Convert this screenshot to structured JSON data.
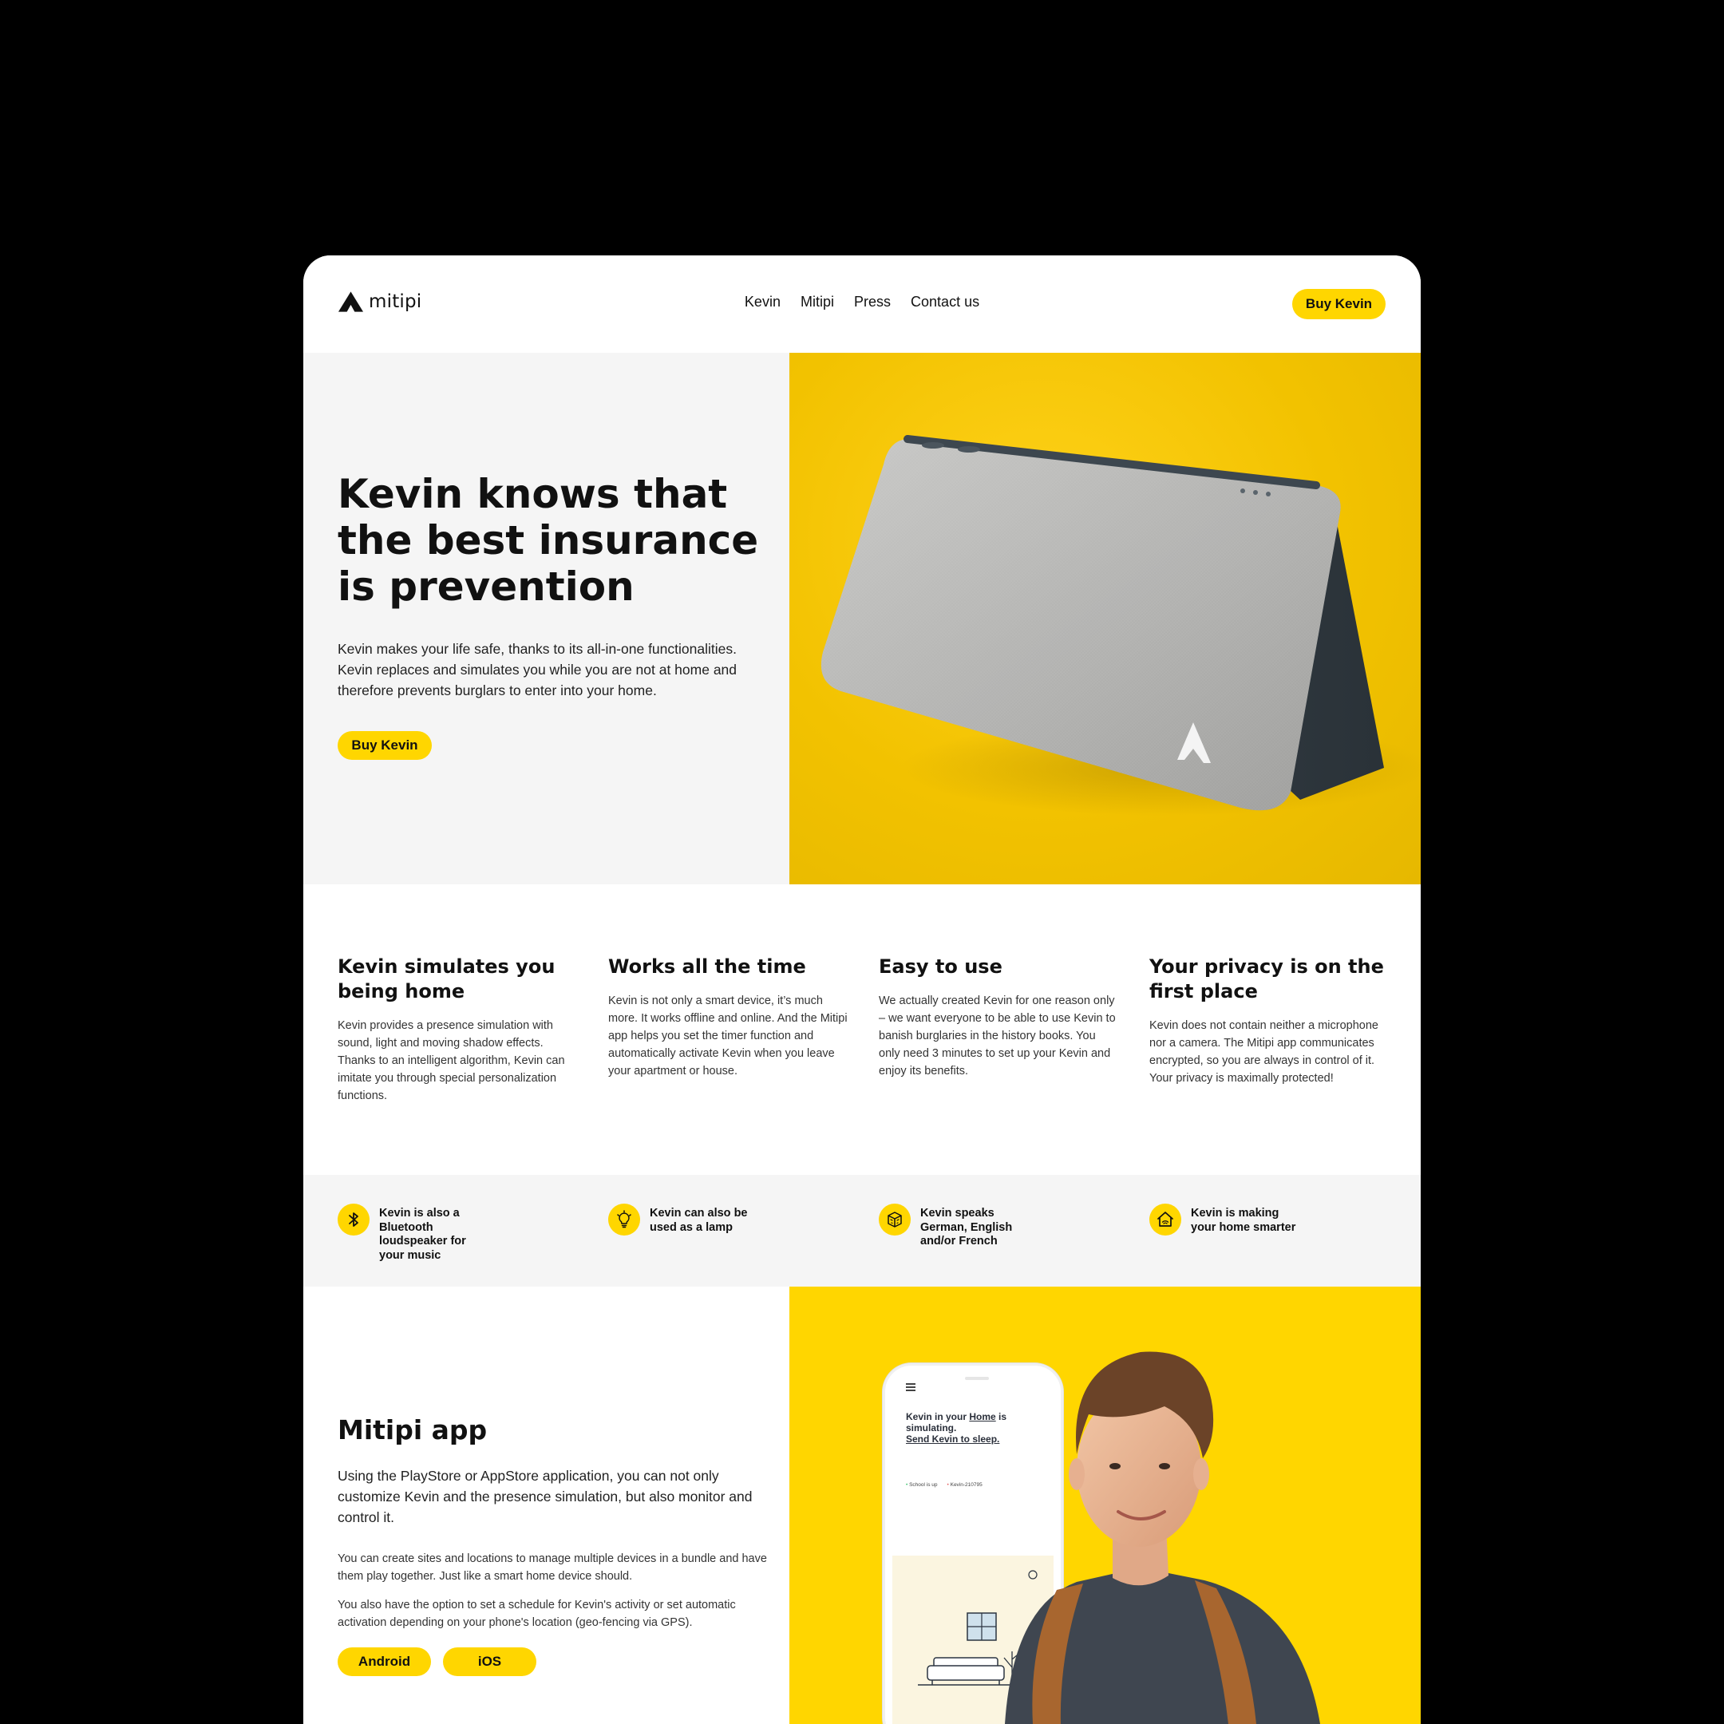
{
  "brand": {
    "name": "mitipi",
    "accent": "#FFD600"
  },
  "nav": {
    "links": [
      "Kevin",
      "Mitipi",
      "Press",
      "Contact us"
    ],
    "cta": "Buy Kevin"
  },
  "hero": {
    "title": "Kevin knows that the best insurance is prevention",
    "text": "Kevin makes your life safe, thanks to its all-in-one functionalities. Kevin replaces and simulates you while you are not at home and therefore prevents burglars to enter into your home.",
    "cta": "Buy Kevin",
    "image": "kevin-device-photo"
  },
  "features": [
    {
      "title": "Kevin simulates you being home",
      "text": "Kevin provides a presence simulation with sound, light and moving shadow effects. Thanks to an intelligent algorithm, Kevin can imitate you through special personalization functions."
    },
    {
      "title": "Works all the time",
      "text": "Kevin is not only a smart device, it’s much more. It works offline and online. And the Mitipi app helps you set the timer function and automatically activate Kevin when you leave your apartment or house."
    },
    {
      "title": "Easy to use",
      "text": "We actually created Kevin for one reason only – we want everyone to be able to use Kevin to banish burglaries in the history books. You only need 3 minutes to set up your Kevin and enjoy its benefits."
    },
    {
      "title": "Your privacy is on the first place",
      "text": "Kevin does not contain neither a microphone nor a camera. The Mitipi app communicates encrypted, so you are always in control of it. Your privacy is maximally protected!"
    }
  ],
  "mini_features": [
    {
      "icon": "bluetooth-icon",
      "text": "Kevin is also a Bluetooth loudspeaker for your music"
    },
    {
      "icon": "lightbulb-icon",
      "text": "Kevin can also be used as a lamp"
    },
    {
      "icon": "language-cube-icon",
      "text": "Kevin speaks German, English and/or French"
    },
    {
      "icon": "smart-home-icon",
      "text": "Kevin is making your home smarter"
    }
  ],
  "app": {
    "title": "Mitipi app",
    "lead": "Using the PlayStore or AppStore application, you can not only customize Kevin and the presence simulation, but also monitor and control it.",
    "p1": "You can create sites and locations to manage multiple devices in a bundle and have them play together. Just like a smart home device should.",
    "p2": "You also have the option to set a schedule for Kevin's activity or set automatic activation depending on your phone's location (geo-fencing via GPS).",
    "android": "Android",
    "ios": "iOS",
    "phone": {
      "line1_pre": "Kevin in your ",
      "line1_link": "Home",
      "line1_post": " is simulating.",
      "line2": "Send Kevin to sleep.",
      "status1": "School is up",
      "status2": "Kevin-210795"
    }
  }
}
